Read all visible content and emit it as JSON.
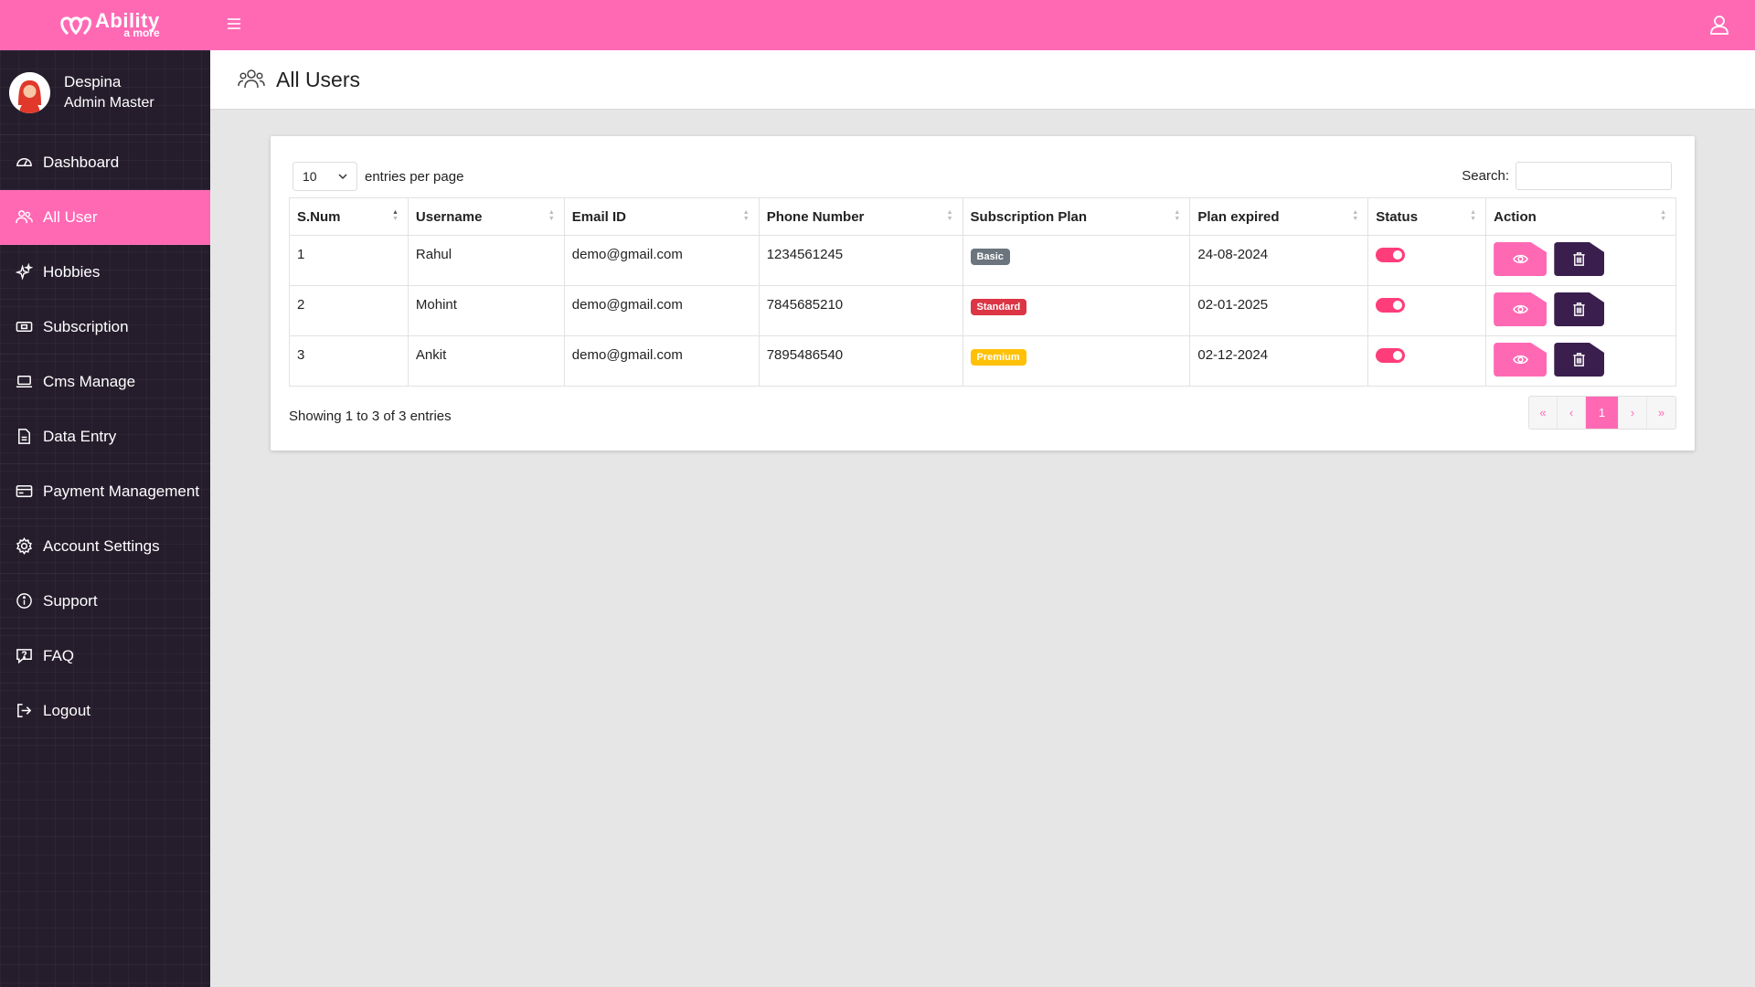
{
  "brand": {
    "name": "Ability",
    "sub": "a more"
  },
  "profile": {
    "name": "Despina",
    "role": "Admin Master"
  },
  "nav": [
    {
      "label": "Dashboard",
      "icon": "dashboard-icon",
      "active": false
    },
    {
      "label": "All User",
      "icon": "users-icon",
      "active": true
    },
    {
      "label": "Hobbies",
      "icon": "sparkles-icon",
      "active": false
    },
    {
      "label": "Subscription",
      "icon": "cash-icon",
      "active": false
    },
    {
      "label": "Cms Manage",
      "icon": "laptop-icon",
      "active": false
    },
    {
      "label": "Data Entry",
      "icon": "document-icon",
      "active": false
    },
    {
      "label": "Payment Management",
      "icon": "credit-card-icon",
      "active": false
    },
    {
      "label": "Account Settings",
      "icon": "gear-icon",
      "active": false
    },
    {
      "label": "Support",
      "icon": "info-icon",
      "active": false
    },
    {
      "label": "FAQ",
      "icon": "question-icon",
      "active": false
    },
    {
      "label": "Logout",
      "icon": "logout-icon",
      "active": false
    }
  ],
  "page": {
    "title": "All Users"
  },
  "table": {
    "length_value": "10",
    "length_label": "entries per page",
    "search_label": "Search:",
    "search_value": "",
    "columns": [
      "S.Num",
      "Username",
      "Email ID",
      "Phone Number",
      "Subscription Plan",
      "Plan expired",
      "Status",
      "Action"
    ],
    "rows": [
      {
        "num": "1",
        "username": "Rahul",
        "email": "demo@gmail.com",
        "phone": "1234561245",
        "plan": "Basic",
        "plan_color": "#6c757d",
        "expired": "24-08-2024",
        "status": true
      },
      {
        "num": "2",
        "username": "Mohint",
        "email": "demo@gmail.com",
        "phone": "7845685210",
        "plan": "Standard",
        "plan_color": "#dc3545",
        "expired": "02-01-2025",
        "status": true
      },
      {
        "num": "3",
        "username": "Ankit",
        "email": "demo@gmail.com",
        "phone": "7895486540",
        "plan": "Premium",
        "plan_color": "#ffc107",
        "expired": "02-12-2024",
        "status": true
      }
    ],
    "info": "Showing 1 to 3 of 3 entries",
    "pager": {
      "first": "«",
      "prev": "‹",
      "current": "1",
      "next": "›",
      "last": "»"
    }
  },
  "colors": {
    "primary": "#ff69b4",
    "sidebar": "#251d2c",
    "delete": "#3a1f4e",
    "toggle": "#ff3d7a"
  }
}
